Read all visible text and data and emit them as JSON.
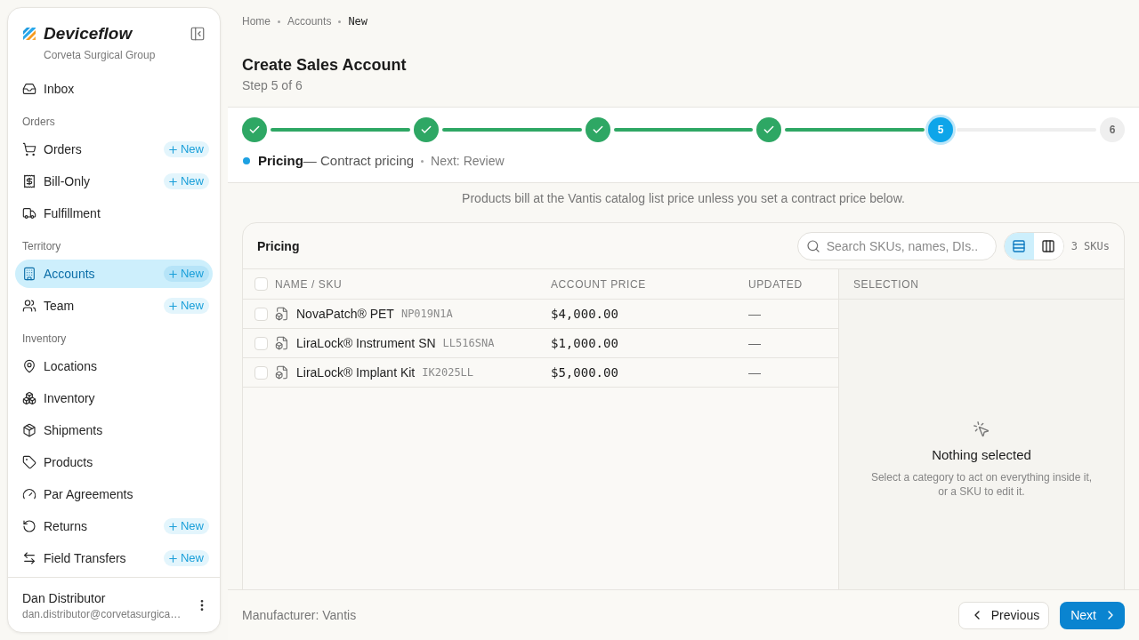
{
  "sidebar": {
    "brand": "Deviceflow",
    "organization": "Corveta Surgical Group",
    "nav": [
      {
        "items": [
          {
            "label": "Inbox",
            "selected": false
          }
        ]
      },
      {
        "heading": "Orders",
        "items": [
          {
            "label": "Orders",
            "selected": false,
            "action": "New"
          },
          {
            "label": "Bill-Only",
            "selected": false,
            "action": "New"
          },
          {
            "label": "Fulfillment",
            "selected": false
          }
        ]
      },
      {
        "heading": "Territory",
        "items": [
          {
            "label": "Accounts",
            "selected": true,
            "action": "New"
          },
          {
            "label": "Team",
            "selected": false,
            "action": "New"
          }
        ]
      },
      {
        "heading": "Inventory",
        "items": [
          {
            "label": "Locations",
            "selected": false
          },
          {
            "label": "Inventory",
            "selected": false
          },
          {
            "label": "Shipments",
            "selected": false
          },
          {
            "label": "Products",
            "selected": false
          },
          {
            "label": "Par Agreements",
            "selected": false
          },
          {
            "label": "Returns",
            "selected": false,
            "action": "New"
          },
          {
            "label": "Field Transfers",
            "selected": false,
            "action": "New"
          }
        ]
      }
    ],
    "user": {
      "name": "Dan Distributor",
      "email": "dan.distributor@corvetasurgica…"
    }
  },
  "breadcrumb": [
    {
      "label": "Home",
      "current": false
    },
    {
      "label": "Accounts",
      "current": false
    },
    {
      "label": "New",
      "current": true
    }
  ],
  "page": {
    "title": "Create Sales Account",
    "subtitle": "Step 5 of 6"
  },
  "stepper": {
    "steps": [
      {
        "completed": true,
        "current": false
      },
      {
        "completed": true,
        "current": false
      },
      {
        "completed": true,
        "current": false
      },
      {
        "completed": true,
        "current": false
      },
      {
        "completed": false,
        "current": true,
        "number": "5"
      },
      {
        "completed": false,
        "current": false,
        "number": "6"
      }
    ],
    "current_label": "**Pricing**— Contract pricing",
    "next": "Next: Review"
  },
  "hint": "Products bill at the Vantis catalog list price unless you set a contract price below.",
  "pricing": {
    "title": "Pricing",
    "search": {
      "placeholder": "Search SKUs, names, DIs.."
    },
    "views": [
      {
        "selected": true
      },
      {
        "selected": false
      }
    ],
    "count": "3 SKUs",
    "table": {
      "select_all_checked": false,
      "columns": [
        "NAME / SKU",
        "ACCOUNT PRICE",
        "UPDATED"
      ],
      "rows": [
        {
          "name": "NovaPatch® PET",
          "sku": "NP019N1A",
          "price": "$4,000.00",
          "updated": "—",
          "checked": false
        },
        {
          "name": "LiraLock® Instrument SN",
          "sku": "LL516SNA",
          "price": "$1,000.00",
          "updated": "—",
          "checked": false
        },
        {
          "name": "LiraLock® Implant Kit",
          "sku": "IK2025LL",
          "price": "$5,000.00",
          "updated": "—",
          "checked": false
        }
      ]
    },
    "selection": {
      "heading": "SELECTION",
      "title": "Nothing selected",
      "text": "Select a category to act on everything inside it, or a SKU to edit it."
    }
  },
  "footer": {
    "manufacturer": "Manufacturer: Vantis",
    "previous": "Previous",
    "next": "Next"
  }
}
